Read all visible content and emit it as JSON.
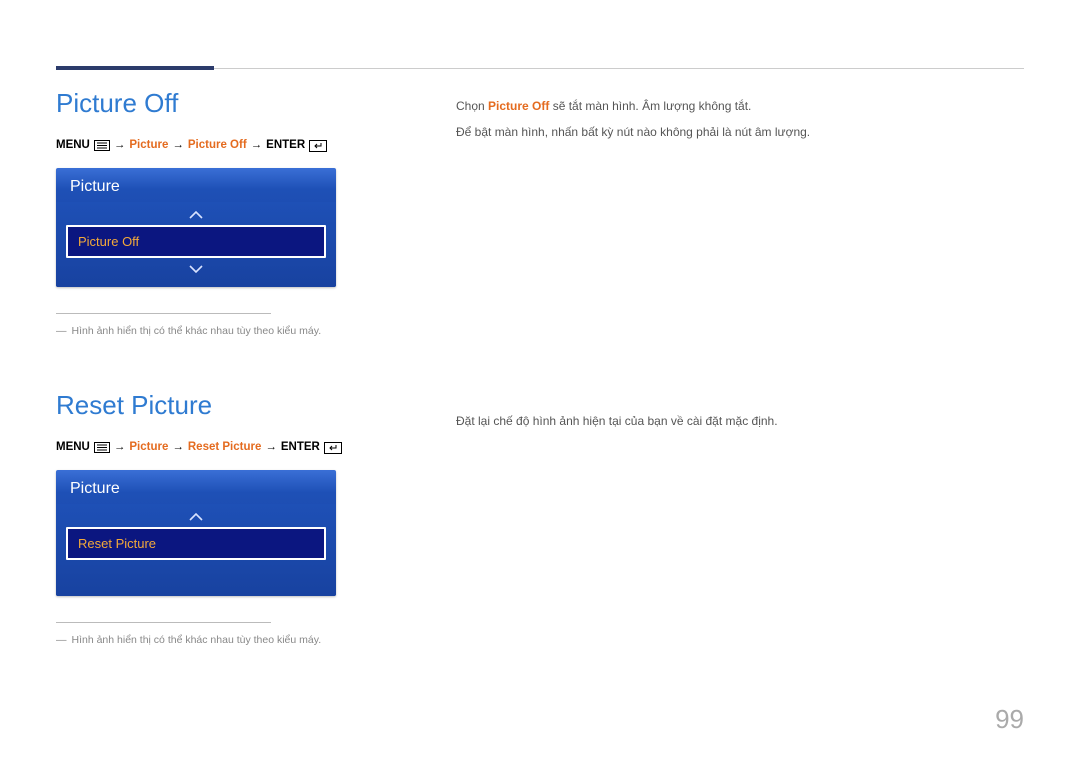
{
  "page_number": "99",
  "section1": {
    "title": "Picture Off",
    "breadcrumb": {
      "menu": "MENU",
      "p1": "Picture",
      "p2": "Picture Off",
      "enter": "ENTER"
    },
    "osd": {
      "title": "Picture",
      "selected": "Picture Off"
    },
    "note": "Hình ảnh hiển thị có thể khác nhau tùy theo kiểu máy.",
    "desc": {
      "line1_pre": "Chọn ",
      "line1_hl": "Picture Off",
      "line1_post": " sẽ tắt màn hình. Âm lượng không tắt.",
      "line2": "Để bật màn hình, nhấn bất kỳ nút nào không phải là nút âm lượng."
    }
  },
  "section2": {
    "title": "Reset Picture",
    "breadcrumb": {
      "menu": "MENU",
      "p1": "Picture",
      "p2": "Reset Picture",
      "enter": "ENTER"
    },
    "osd": {
      "title": "Picture",
      "selected": "Reset Picture"
    },
    "note": "Hình ảnh hiển thị có thể khác nhau tùy theo kiểu máy.",
    "desc": {
      "line1": "Đặt lại chế độ hình ảnh hiện tại của bạn về cài đặt mặc định."
    }
  }
}
